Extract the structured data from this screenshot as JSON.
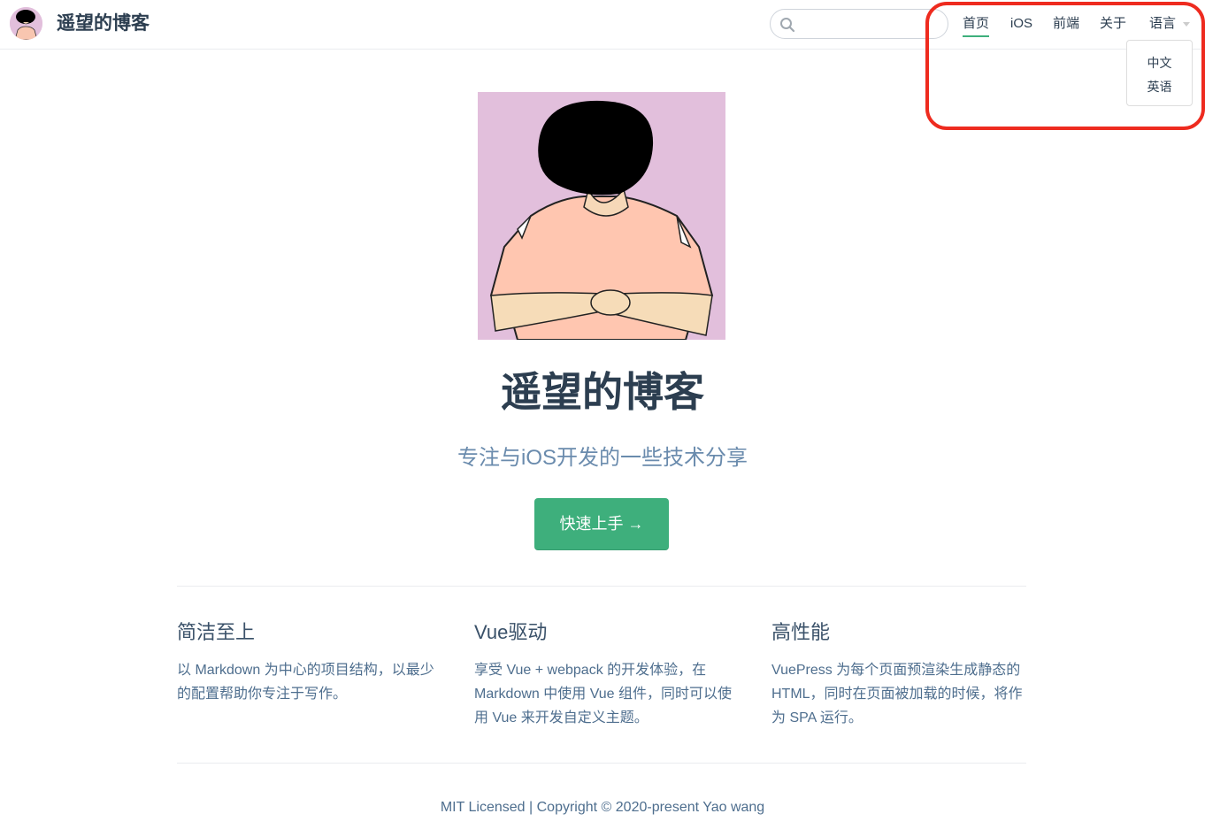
{
  "navbar": {
    "title": "遥望的博客",
    "search": {
      "placeholder": "",
      "value": ""
    },
    "links": [
      "首页",
      "iOS",
      "前端",
      "关于"
    ],
    "active_link": "首页",
    "language_dropdown": {
      "label": "语言",
      "options": [
        "中文",
        "英语"
      ]
    }
  },
  "hero": {
    "title": "遥望的博客",
    "description": "专注与iOS开发的一些技术分享",
    "action_text": "快速上手 →"
  },
  "features": [
    {
      "title": "简洁至上",
      "details": "以 Markdown 为中心的项目结构，以最少的配置帮助你专注于写作。"
    },
    {
      "title": "Vue驱动",
      "details": "享受 Vue + webpack 的开发体验，在 Markdown 中使用 Vue 组件，同时可以使用 Vue 来开发自定义主题。"
    },
    {
      "title": "高性能",
      "details": "VuePress 为每个页面预渲染生成静态的 HTML，同时在页面被加载的时候，将作为 SPA 运行。"
    }
  ],
  "footer": "MIT Licensed | Copyright © 2020-present Yao wang",
  "colors": {
    "accent": "#3eaf7c",
    "text": "#2c3e50",
    "muted": "#6a8bad",
    "highlight": "#ee2b1f",
    "avatar_bg": "#e2bfdc"
  },
  "icons": [
    "search-icon",
    "dropdown-caret-icon",
    "arrow-right-icon"
  ]
}
